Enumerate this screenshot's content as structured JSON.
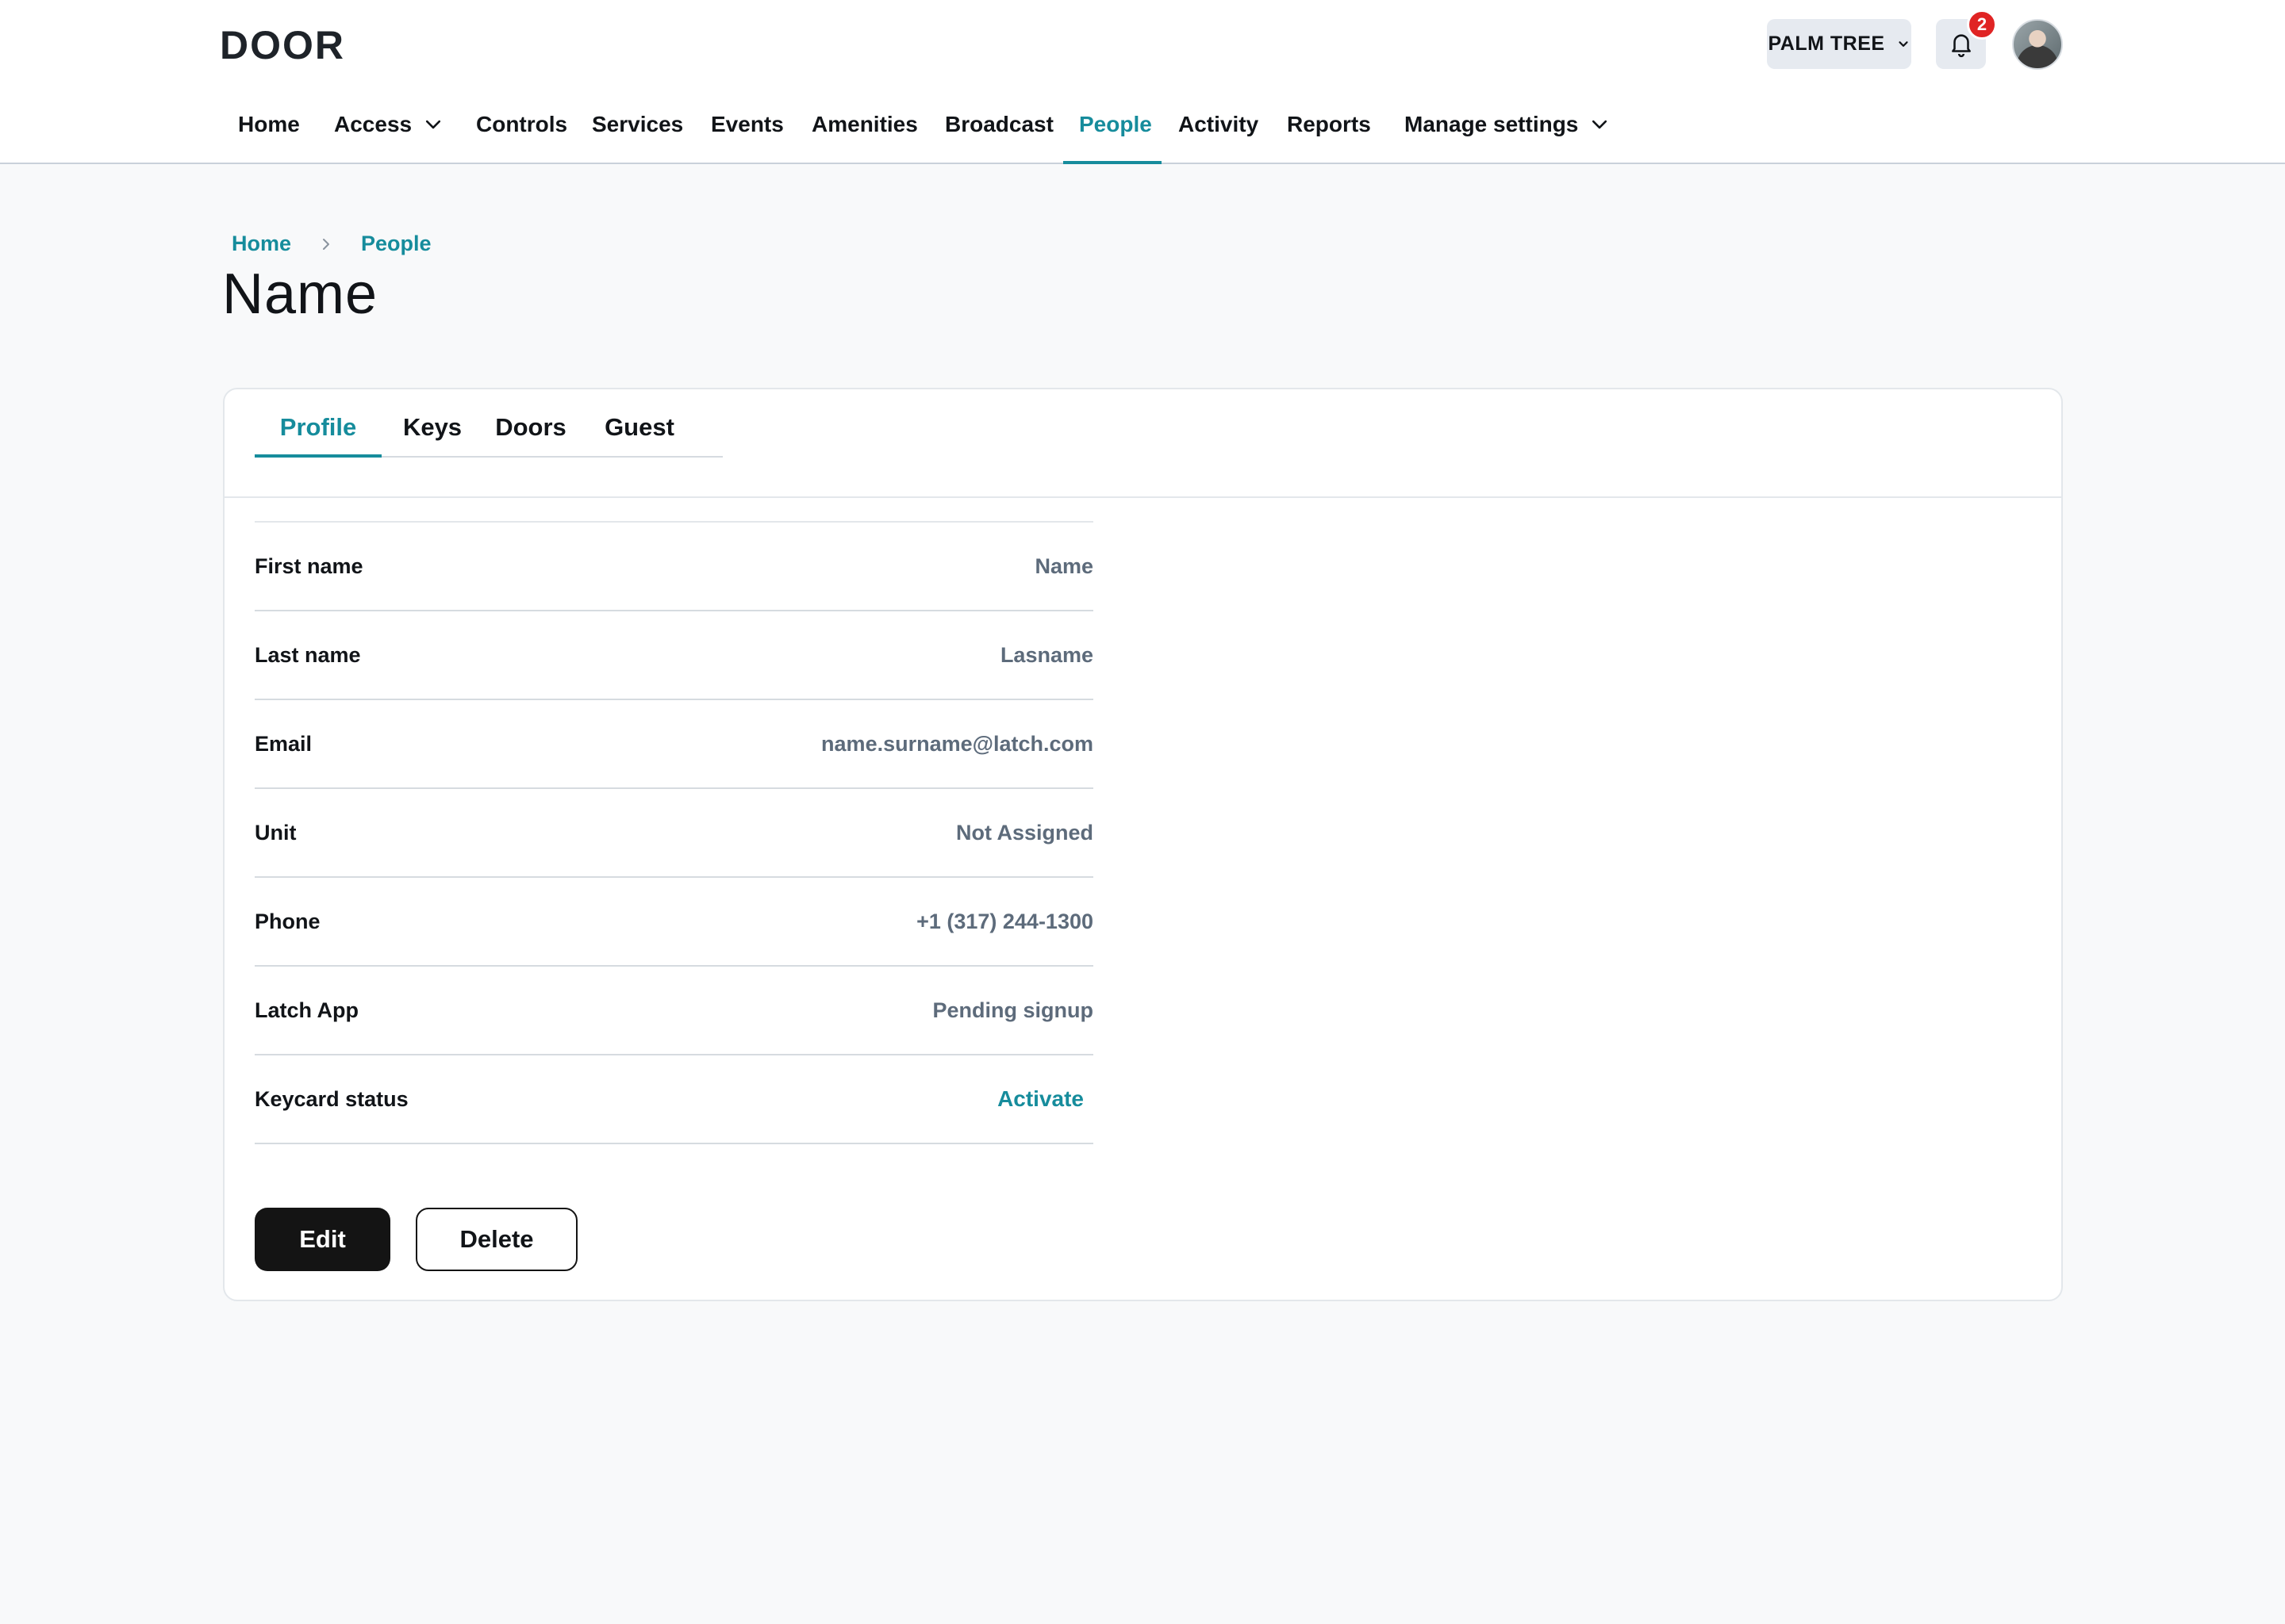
{
  "header": {
    "logo": "DOOR",
    "property_selector": "PALM TREE",
    "notification_count": "2",
    "nav": [
      {
        "label": "Home"
      },
      {
        "label": "Access"
      },
      {
        "label": "Controls"
      },
      {
        "label": "Services"
      },
      {
        "label": "Events"
      },
      {
        "label": "Amenities"
      },
      {
        "label": "Broadcast"
      },
      {
        "label": "People"
      },
      {
        "label": "Activity"
      },
      {
        "label": "Reports"
      },
      {
        "label": "Manage settings"
      }
    ],
    "active_nav": "People"
  },
  "breadcrumb": [
    "Home",
    "People"
  ],
  "page_title": "Name",
  "tabs": [
    {
      "label": "Profile"
    },
    {
      "label": "Keys"
    },
    {
      "label": "Doors"
    },
    {
      "label": "Guest"
    }
  ],
  "active_tab": "Profile",
  "profile": [
    {
      "label": "First name",
      "value": "Name"
    },
    {
      "label": "Last name",
      "value": "Lasname"
    },
    {
      "label": "Email",
      "value": "name.surname@latch.com"
    },
    {
      "label": "Unit",
      "value": "Not Assigned"
    },
    {
      "label": "Phone",
      "value": "+1 (317) 244-1300"
    },
    {
      "label": "Latch App",
      "value": "Pending signup"
    },
    {
      "label": "Keycard status",
      "value": "Activate"
    }
  ],
  "actions": {
    "edit_label": "Edit",
    "delete_label": "Delete"
  },
  "colors": {
    "accent": "#168c9c",
    "badge": "#e02424",
    "primary_button": "#141414"
  },
  "icons": {
    "property_chevron": "chevron-down-icon",
    "notifications": "bell-icon",
    "nav_dropdown": "chevron-down-icon",
    "breadcrumb_separator": "chevron-right-icon"
  }
}
